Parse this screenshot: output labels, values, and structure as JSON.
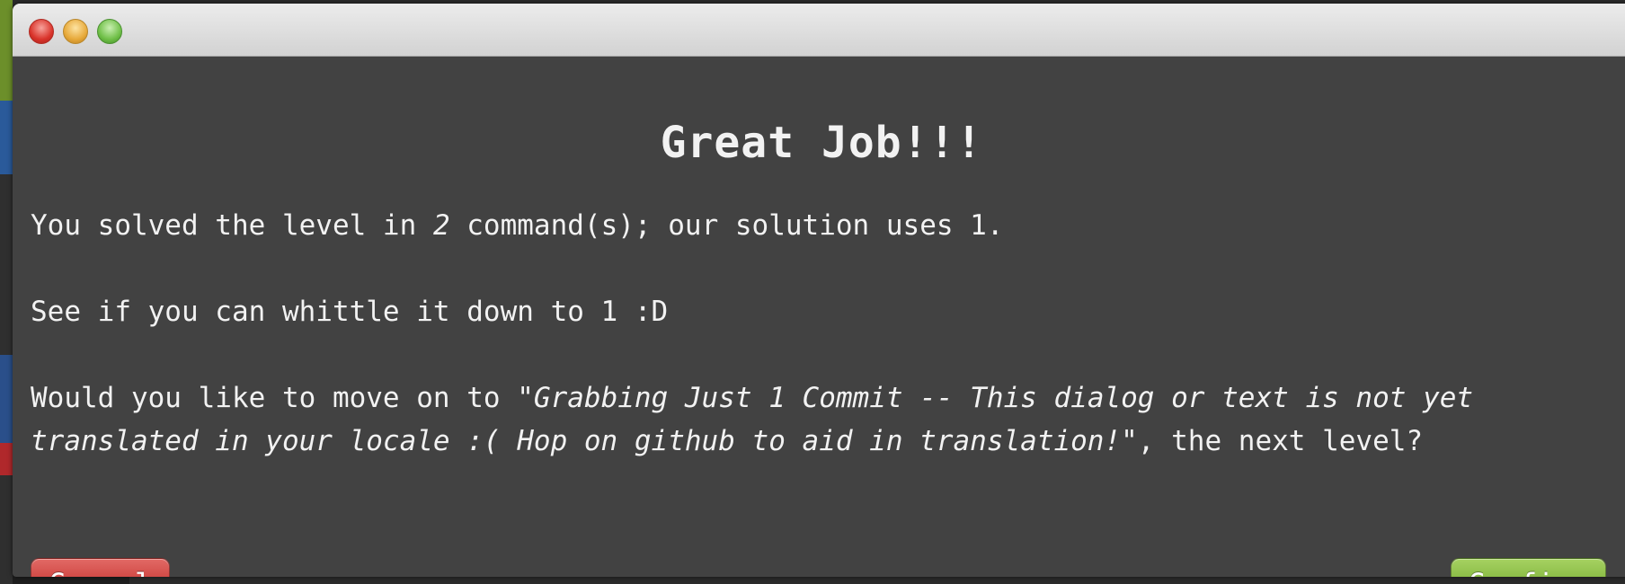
{
  "dialog": {
    "heading": "Great Job!!!",
    "line1_prefix": "You solved the level in ",
    "line1_count": "2",
    "line1_suffix": " command(s); our solution uses 1.",
    "line2": "See if you can whittle it down to 1 :D",
    "line3_prefix": "Would you like to move on to \"",
    "line3_level_a": "Grabbing Just 1 Commit -- This dialog or text is not yet",
    "line3_level_b": "translated in your locale :( Hop on github to aid in translation!",
    "line3_suffix": "\", the next level?",
    "cancel_label": "Cancel",
    "confirm_label": "Confirm"
  },
  "window_controls": [
    "close",
    "minimize",
    "zoom"
  ],
  "colors": {
    "dialog_background": "#424242",
    "cancel": "#c93a36",
    "confirm": "#7fb23a"
  }
}
